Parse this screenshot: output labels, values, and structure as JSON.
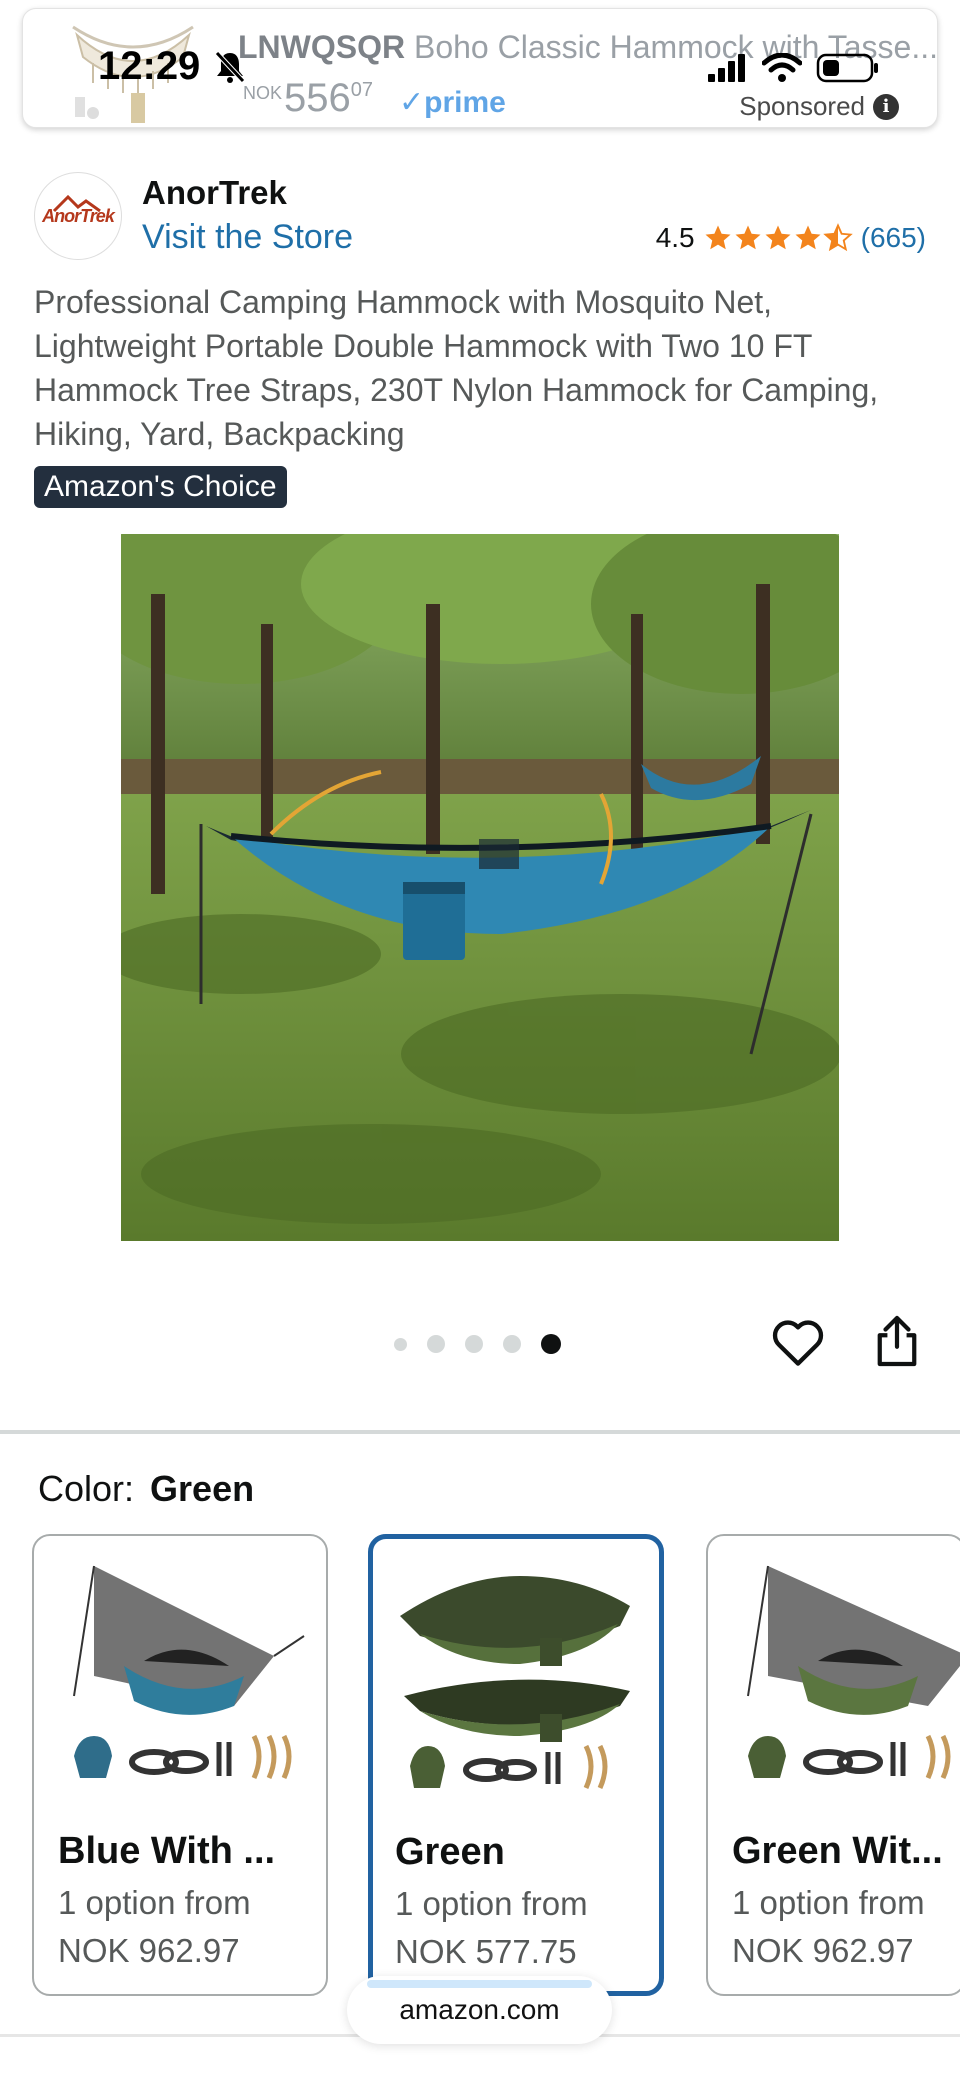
{
  "status_bar": {
    "time": "12:29"
  },
  "sponsored_ad": {
    "brand": "LNWQSQR",
    "title": "Boho Classic Hammock with Tasse...",
    "price_currency": "NOK",
    "price_int": "556",
    "price_dec": "07",
    "prime_label": "prime",
    "sponsored_label": "Sponsored",
    "info_icon": "i"
  },
  "brand": {
    "logo_text": "AnorTrek",
    "name": "AnorTrek",
    "store_link": "Visit the Store"
  },
  "rating": {
    "value": "4.5",
    "stars": 4.5,
    "count": "(665)"
  },
  "product": {
    "title": "Professional Camping Hammock with Mosquito Net, Lightweight Portable Double Hammock with Two 10 FT Hammock Tree Straps, 230T Nylon Hammock for Camping, Hiking, Yard, Backpacking",
    "badge": "Amazon's Choice"
  },
  "carousel": {
    "total": 5,
    "active": 5
  },
  "color_selector": {
    "label": "Color:",
    "selected": "Green",
    "options": [
      {
        "name": "Blue With ...",
        "availability": "1 option from",
        "price": "NOK 962.97"
      },
      {
        "name": "Green",
        "availability": "1 option from",
        "price": "NOK 577.75"
      },
      {
        "name": "Green Wit...",
        "availability": "1 option from",
        "price": "NOK 962.97"
      }
    ]
  },
  "browser": {
    "url": "amazon.com"
  },
  "colors": {
    "link_blue": "#1f6fa8",
    "star_orange": "#f3841c",
    "selected_border": "#2162a1",
    "badge_bg": "#232f3e"
  }
}
